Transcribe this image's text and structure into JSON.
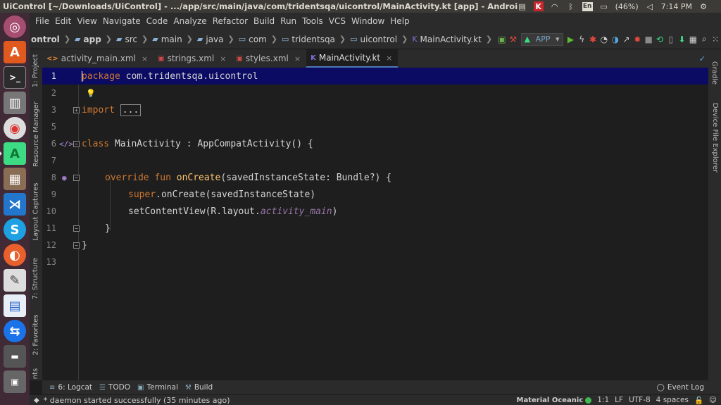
{
  "window": {
    "title": "UiControl [~/Downloads/UiControl] - .../app/src/main/java/com/tridentsqa/uicontrol/MainActivity.kt [app] - Android Studio"
  },
  "system_tray": {
    "language": "En",
    "battery": "(46%)",
    "time": "7:14 PM"
  },
  "menu": {
    "items": [
      "File",
      "Edit",
      "View",
      "Navigate",
      "Code",
      "Analyze",
      "Refactor",
      "Build",
      "Run",
      "Tools",
      "VCS",
      "Window",
      "Help"
    ]
  },
  "breadcrumb": {
    "items": [
      "ontrol",
      "app",
      "src",
      "main",
      "java",
      "com",
      "tridentsqa",
      "uicontrol",
      "MainActivity.kt"
    ]
  },
  "toolbar": {
    "run_config": "APP"
  },
  "left_tool_windows": [
    "1: Project",
    "Resource Manager",
    "Layout Captures",
    "7: Structure",
    "2: Favorites",
    "nts"
  ],
  "right_tool_windows": [
    "Gradle",
    "Device File Explorer"
  ],
  "tabs": [
    {
      "label": "activity_main.xml",
      "icon": "xml-file-icon"
    },
    {
      "label": "strings.xml",
      "icon": "xml-file-icon"
    },
    {
      "label": "styles.xml",
      "icon": "xml-file-icon"
    },
    {
      "label": "MainActivity.kt",
      "icon": "kotlin-file-icon",
      "active": true
    }
  ],
  "editor": {
    "line_numbers": [
      "1",
      "2",
      "3",
      "5",
      "6",
      "7",
      "8",
      "9",
      "10",
      "11",
      "12",
      "13"
    ],
    "code": {
      "l1_kw": "package",
      "l1_rest": " com.tridentsqa.uicontrol",
      "l3_kw": "import",
      "l3_fold": "...",
      "l6_kw": "class",
      "l6_rest": " MainActivity : AppCompatActivity() {",
      "l8_kw": "override fun",
      "l8_fn": "onCreate",
      "l8_rest": "(savedInstanceState: Bundle?) {",
      "l9_kw": "super",
      "l9_rest": ".onCreate(savedInstanceState)",
      "l10_a": "setContentView(R.layout.",
      "l10_it": "activity_main",
      "l10_b": ")",
      "l11": "}",
      "l12": "}"
    }
  },
  "bottom_tools": [
    {
      "label": "6: Logcat",
      "icon": "logcat-icon"
    },
    {
      "label": "TODO",
      "icon": "todo-icon"
    },
    {
      "label": "Terminal",
      "icon": "terminal-icon"
    },
    {
      "label": "Build",
      "icon": "build-icon"
    }
  ],
  "event_log": "Event Log",
  "status": {
    "message": "* daemon started successfully (35 minutes ago)",
    "theme": "Material Oceanic",
    "position": "1:1",
    "line_sep": "LF",
    "encoding": "UTF-8",
    "indent": "4 spaces"
  }
}
